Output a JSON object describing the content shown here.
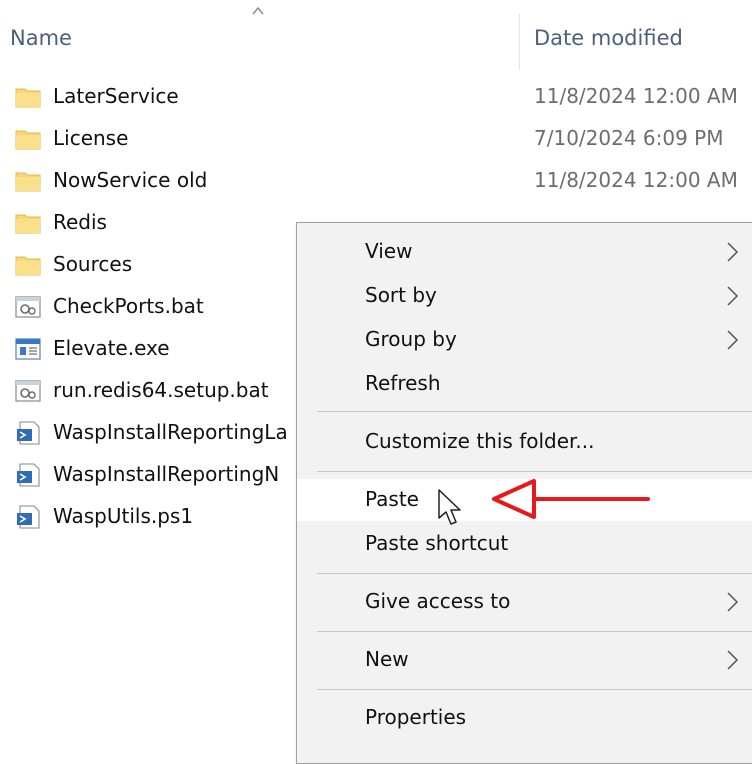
{
  "header": {
    "name_label": "Name",
    "date_label": "Date modified"
  },
  "files": [
    {
      "name": "LaterService",
      "date": "11/8/2024 12:00 AM",
      "icon": "folder-icon"
    },
    {
      "name": "License",
      "date": "7/10/2024 6:09 PM",
      "icon": "folder-icon"
    },
    {
      "name": "NowService old",
      "date": "11/8/2024 12:00 AM",
      "icon": "folder-icon"
    },
    {
      "name": "Redis",
      "date": "",
      "icon": "folder-icon"
    },
    {
      "name": "Sources",
      "date": "",
      "icon": "folder-icon"
    },
    {
      "name": "CheckPorts.bat",
      "date": "",
      "icon": "batch-file-icon"
    },
    {
      "name": "Elevate.exe",
      "date": "",
      "icon": "executable-icon"
    },
    {
      "name": "run.redis64.setup.bat",
      "date": "",
      "icon": "batch-file-icon"
    },
    {
      "name": "WaspInstallReportingLa",
      "date": "",
      "icon": "powershell-script-icon"
    },
    {
      "name": "WaspInstallReportingN",
      "date": "",
      "icon": "powershell-script-icon"
    },
    {
      "name": "WaspUtils.ps1",
      "date": "",
      "icon": "powershell-script-icon"
    }
  ],
  "context_menu": {
    "view": "View",
    "sort_by": "Sort by",
    "group_by": "Group by",
    "refresh": "Refresh",
    "customize": "Customize this folder...",
    "paste": "Paste",
    "paste_shortcut": "Paste shortcut",
    "give_access": "Give access to",
    "new": "New",
    "properties": "Properties"
  },
  "colors": {
    "folder": "#f8d775",
    "menu_bg": "#f2f2f2",
    "highlight": "#ffffff",
    "annotation_arrow": "#e8191b"
  }
}
